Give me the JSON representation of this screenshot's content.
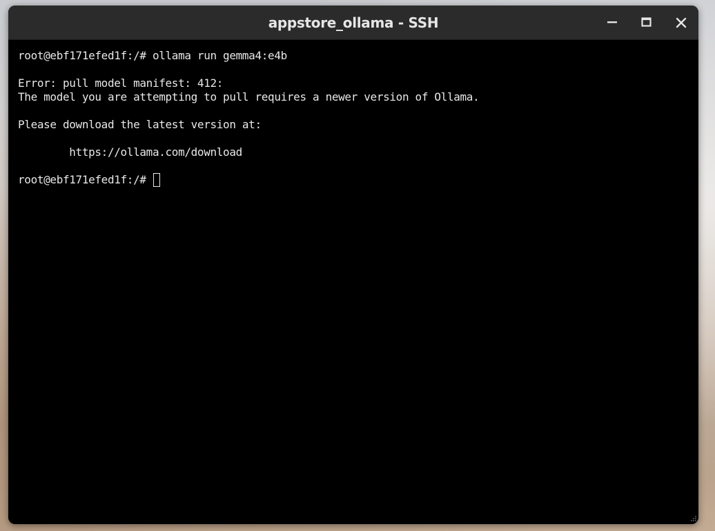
{
  "window": {
    "title": "appstore_ollama - SSH",
    "controls": {
      "minimize_icon": "minimize-icon",
      "maximize_icon": "maximize-icon",
      "close_icon": "close-icon"
    }
  },
  "terminal": {
    "lines": [
      "root@ebf171efed1f:/# ollama run gemma4:e4b",
      "",
      "Error: pull model manifest: 412:",
      "The model you are attempting to pull requires a newer version of Ollama.",
      "",
      "Please download the latest version at:",
      "",
      "        https://ollama.com/download",
      ""
    ],
    "prompt": "root@ebf171efed1f:/# "
  },
  "colors": {
    "titlebar_bg": "#2b2b2b",
    "terminal_bg": "#000000",
    "terminal_fg": "#e8e8e8"
  }
}
